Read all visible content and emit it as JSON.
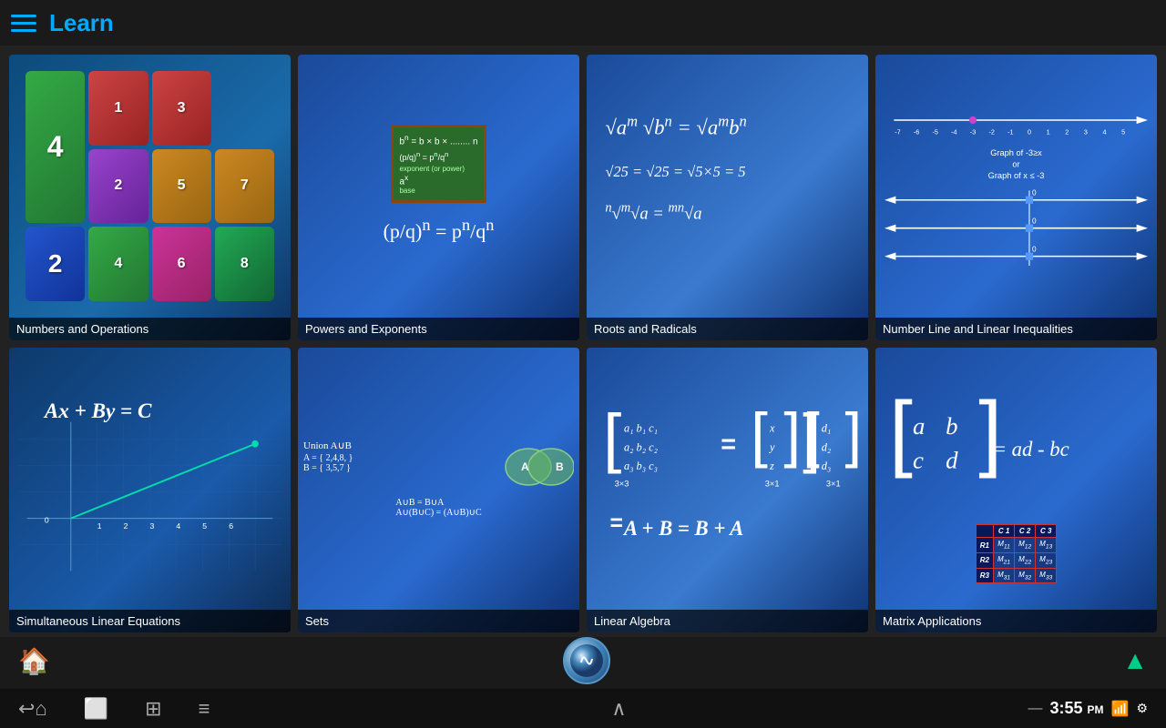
{
  "header": {
    "title": "Learn"
  },
  "topics": [
    {
      "id": "numbers-operations",
      "label": "Numbers and Operations",
      "type": "numbers"
    },
    {
      "id": "powers-exponents",
      "label": "Powers and Exponents",
      "type": "powers"
    },
    {
      "id": "roots-radicals",
      "label": "Roots and Radicals",
      "type": "roots"
    },
    {
      "id": "number-line",
      "label": "Number Line and Linear Inequalities",
      "type": "numberline"
    },
    {
      "id": "simultaneous-linear",
      "label": "Simultaneous Linear Equations",
      "type": "linear"
    },
    {
      "id": "sets",
      "label": "Sets",
      "type": "sets"
    },
    {
      "id": "linear-algebra",
      "label": "Linear Algebra",
      "type": "linalg"
    },
    {
      "id": "matrix-applications",
      "label": "Matrix Applications",
      "type": "matrix"
    }
  ],
  "nav": {
    "time": "3:55",
    "ampm": "PM",
    "home_label": "home",
    "back_label": "back",
    "menu_label": "menu",
    "up_label": "up"
  },
  "number_blocks": [
    {
      "val": "4",
      "color": "#2a8a3a"
    },
    {
      "val": "1",
      "color": "#cc3333"
    },
    {
      "val": "3",
      "color": "#cc3333"
    },
    {
      "val": "",
      "color": "transparent"
    },
    {
      "val": "",
      "color": "transparent"
    },
    {
      "val": "2",
      "color": "#8844bb"
    },
    {
      "val": "5",
      "color": "#cc8822"
    },
    {
      "val": "7",
      "color": "#cc8822"
    },
    {
      "val": "2",
      "color": "#2255aa"
    },
    {
      "val": "4",
      "color": "#228833"
    },
    {
      "val": "6",
      "color": "#cc3399"
    },
    {
      "val": "8",
      "color": "#228855"
    }
  ]
}
